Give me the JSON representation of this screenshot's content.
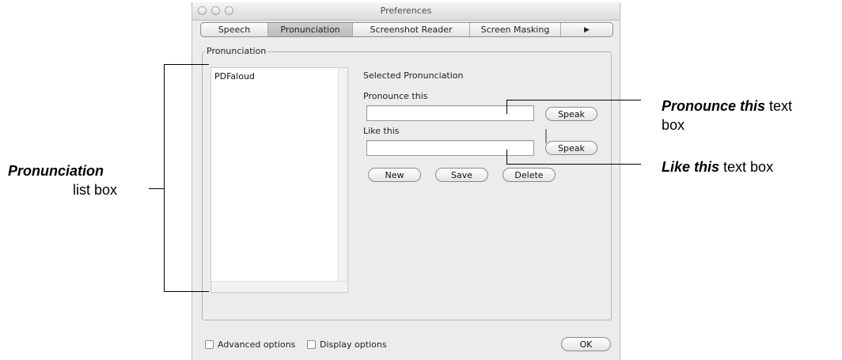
{
  "window": {
    "title": "Preferences"
  },
  "tabs": [
    {
      "label": "Speech"
    },
    {
      "label": "Pronunciation"
    },
    {
      "label": "Screenshot Reader"
    },
    {
      "label": "Screen Masking"
    },
    {
      "label": "▶"
    }
  ],
  "group": {
    "title": "Pronunciation"
  },
  "list": {
    "items": [
      "PDFaloud"
    ]
  },
  "selected_heading": "Selected Pronunciation",
  "fields": {
    "pronounce_label": "Pronounce this",
    "pronounce_value": "",
    "like_label": "Like this",
    "like_value": ""
  },
  "buttons": {
    "speak1": "Speak",
    "speak2": "Speak",
    "new": "New",
    "save": "Save",
    "delete": "Delete",
    "ok": "OK"
  },
  "checkboxes": {
    "advanced": "Advanced options",
    "display": "Display options"
  },
  "annotations": {
    "list_bold": "Pronunciation",
    "list_rest": "list box",
    "pronounce_bold": "Pronounce this",
    "pronounce_rest1": " text",
    "pronounce_rest2": "box",
    "like_bold": "Like this",
    "like_rest": " text box"
  }
}
